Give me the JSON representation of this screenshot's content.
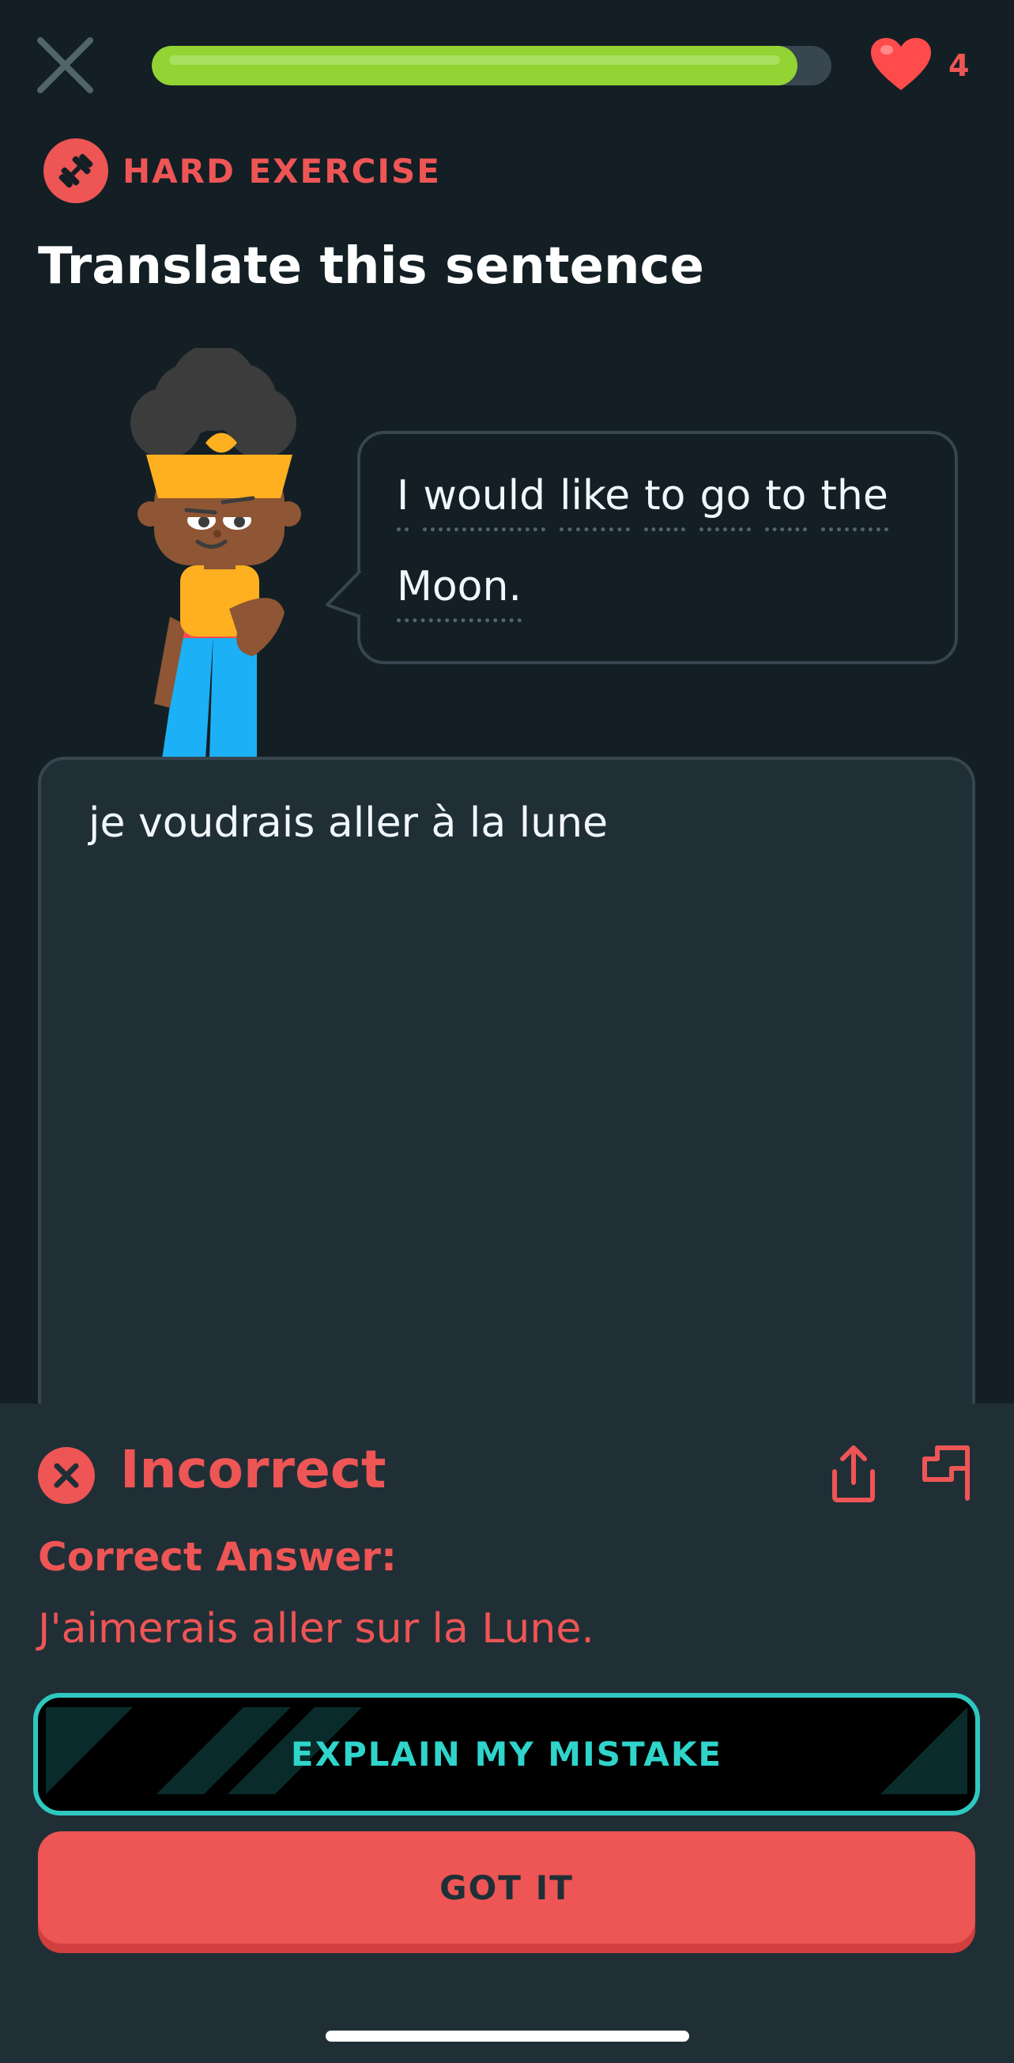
{
  "top_bar": {
    "close_icon": "close-icon",
    "progress_fraction": 0.95,
    "hearts": "4",
    "heart_icon": "heart-icon"
  },
  "exercise": {
    "badge_label": "HARD EXERCISE",
    "badge_icon": "dumbbell-icon",
    "title": "Translate this sentence",
    "prompt_line1": [
      "I",
      "would",
      "like",
      "to",
      "go",
      "to",
      "the"
    ],
    "prompt_line2": [
      "Moon."
    ]
  },
  "answer": {
    "text": "je voudrais aller à la lune"
  },
  "feedback": {
    "status": "Incorrect",
    "status_icon": "x-circle-icon",
    "correct_label": "Correct Answer:",
    "correct_answer": "J'aimerais aller sur la Lune.",
    "share_icon": "share-icon",
    "flag_icon": "flag-icon",
    "explain_button": "EXPLAIN MY MISTAKE",
    "got_it_button": "GOT IT"
  },
  "colors": {
    "background": "#131f24",
    "panel": "#202f36",
    "error": "#ee5555",
    "progress": "#93d333",
    "explain_accent": "#2fc8c0"
  }
}
